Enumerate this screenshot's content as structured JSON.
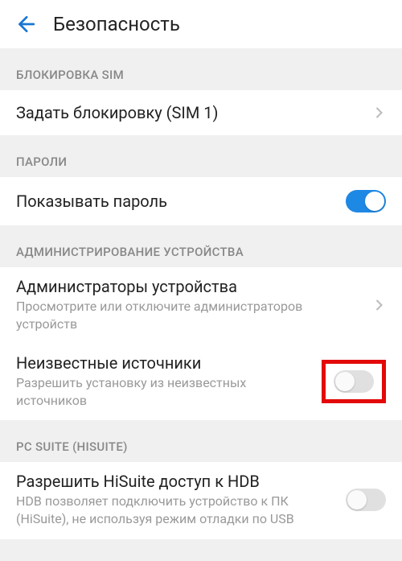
{
  "header": {
    "title": "Безопасность"
  },
  "sections": {
    "sim": {
      "header": "БЛОКИРОВКА SIM",
      "set_lock": "Задать блокировку (SIM 1)"
    },
    "passwords": {
      "header": "ПАРОЛИ",
      "show_password": "Показывать пароль",
      "show_password_on": true
    },
    "admin": {
      "header": "АДМИНИСТРИРОВАНИЕ УСТРОЙСТВА",
      "device_admins_title": "Администраторы устройства",
      "device_admins_sub": "Просмотрите или отключите администраторов устройств",
      "unknown_sources_title": "Неизвестные источники",
      "unknown_sources_sub": "Разрешить установку из неизвестных источников",
      "unknown_sources_on": false
    },
    "pcsuite": {
      "header": "PC SUITE (HISUITE)",
      "hdb_title": "Разрешить HiSuite доступ к HDB",
      "hdb_sub": "HDB позволяет подключить устройство к ПК (HiSuite), не используя режим отладки по USB",
      "hdb_on": false
    }
  }
}
